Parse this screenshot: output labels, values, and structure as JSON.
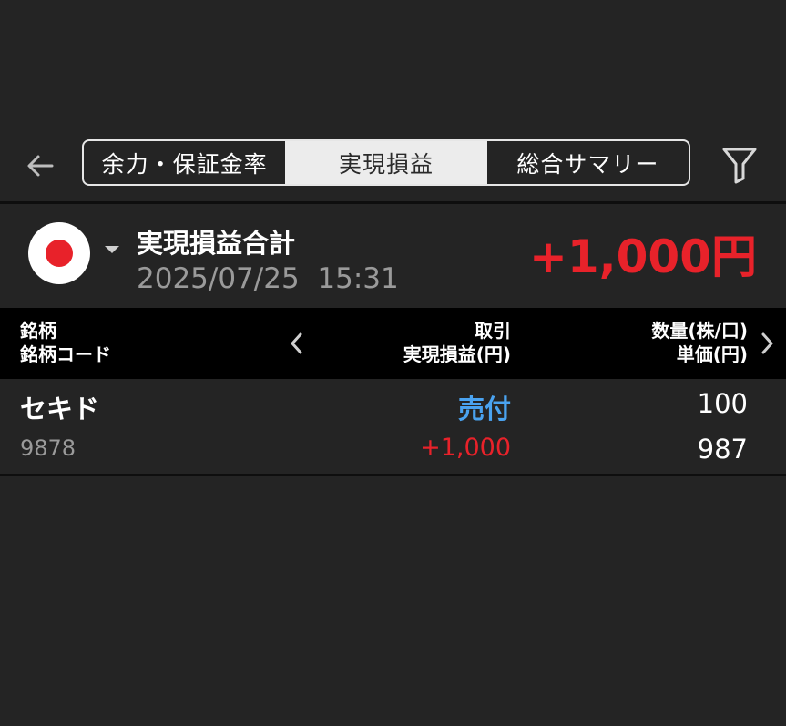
{
  "header": {
    "tabs": [
      {
        "label": "余力・保証金率",
        "active": false
      },
      {
        "label": "実現損益",
        "active": true
      },
      {
        "label": "総合サマリー",
        "active": false
      }
    ]
  },
  "summary": {
    "market": "Japan",
    "title": "実現損益合計",
    "datetime": "2025/07/25  15:31",
    "total": "+1,000円"
  },
  "table": {
    "columns": [
      {
        "line1": "銘柄",
        "line2": "銘柄コード"
      },
      {
        "line1": "取引",
        "line2": "実現損益(円)"
      },
      {
        "line1": "数量(株/口)",
        "line2": "単価(円)"
      }
    ],
    "rows": [
      {
        "name": "セキド",
        "code": "9878",
        "trade_type": "売付",
        "realized_pl": "+1,000",
        "quantity": "100",
        "unit_price": "987"
      }
    ]
  },
  "colors": {
    "background": "#242424",
    "profit_red": "#e8222a",
    "sell_blue": "#4aa3f0",
    "header_bg": "#000000",
    "active_tab_bg": "#ececec"
  },
  "icons": {
    "back": "arrow-left-icon",
    "filter": "filter-icon",
    "market_flag": "japan-flag-icon",
    "dropdown": "caret-down-icon",
    "prev": "chevron-left-icon",
    "next": "chevron-right-icon"
  }
}
